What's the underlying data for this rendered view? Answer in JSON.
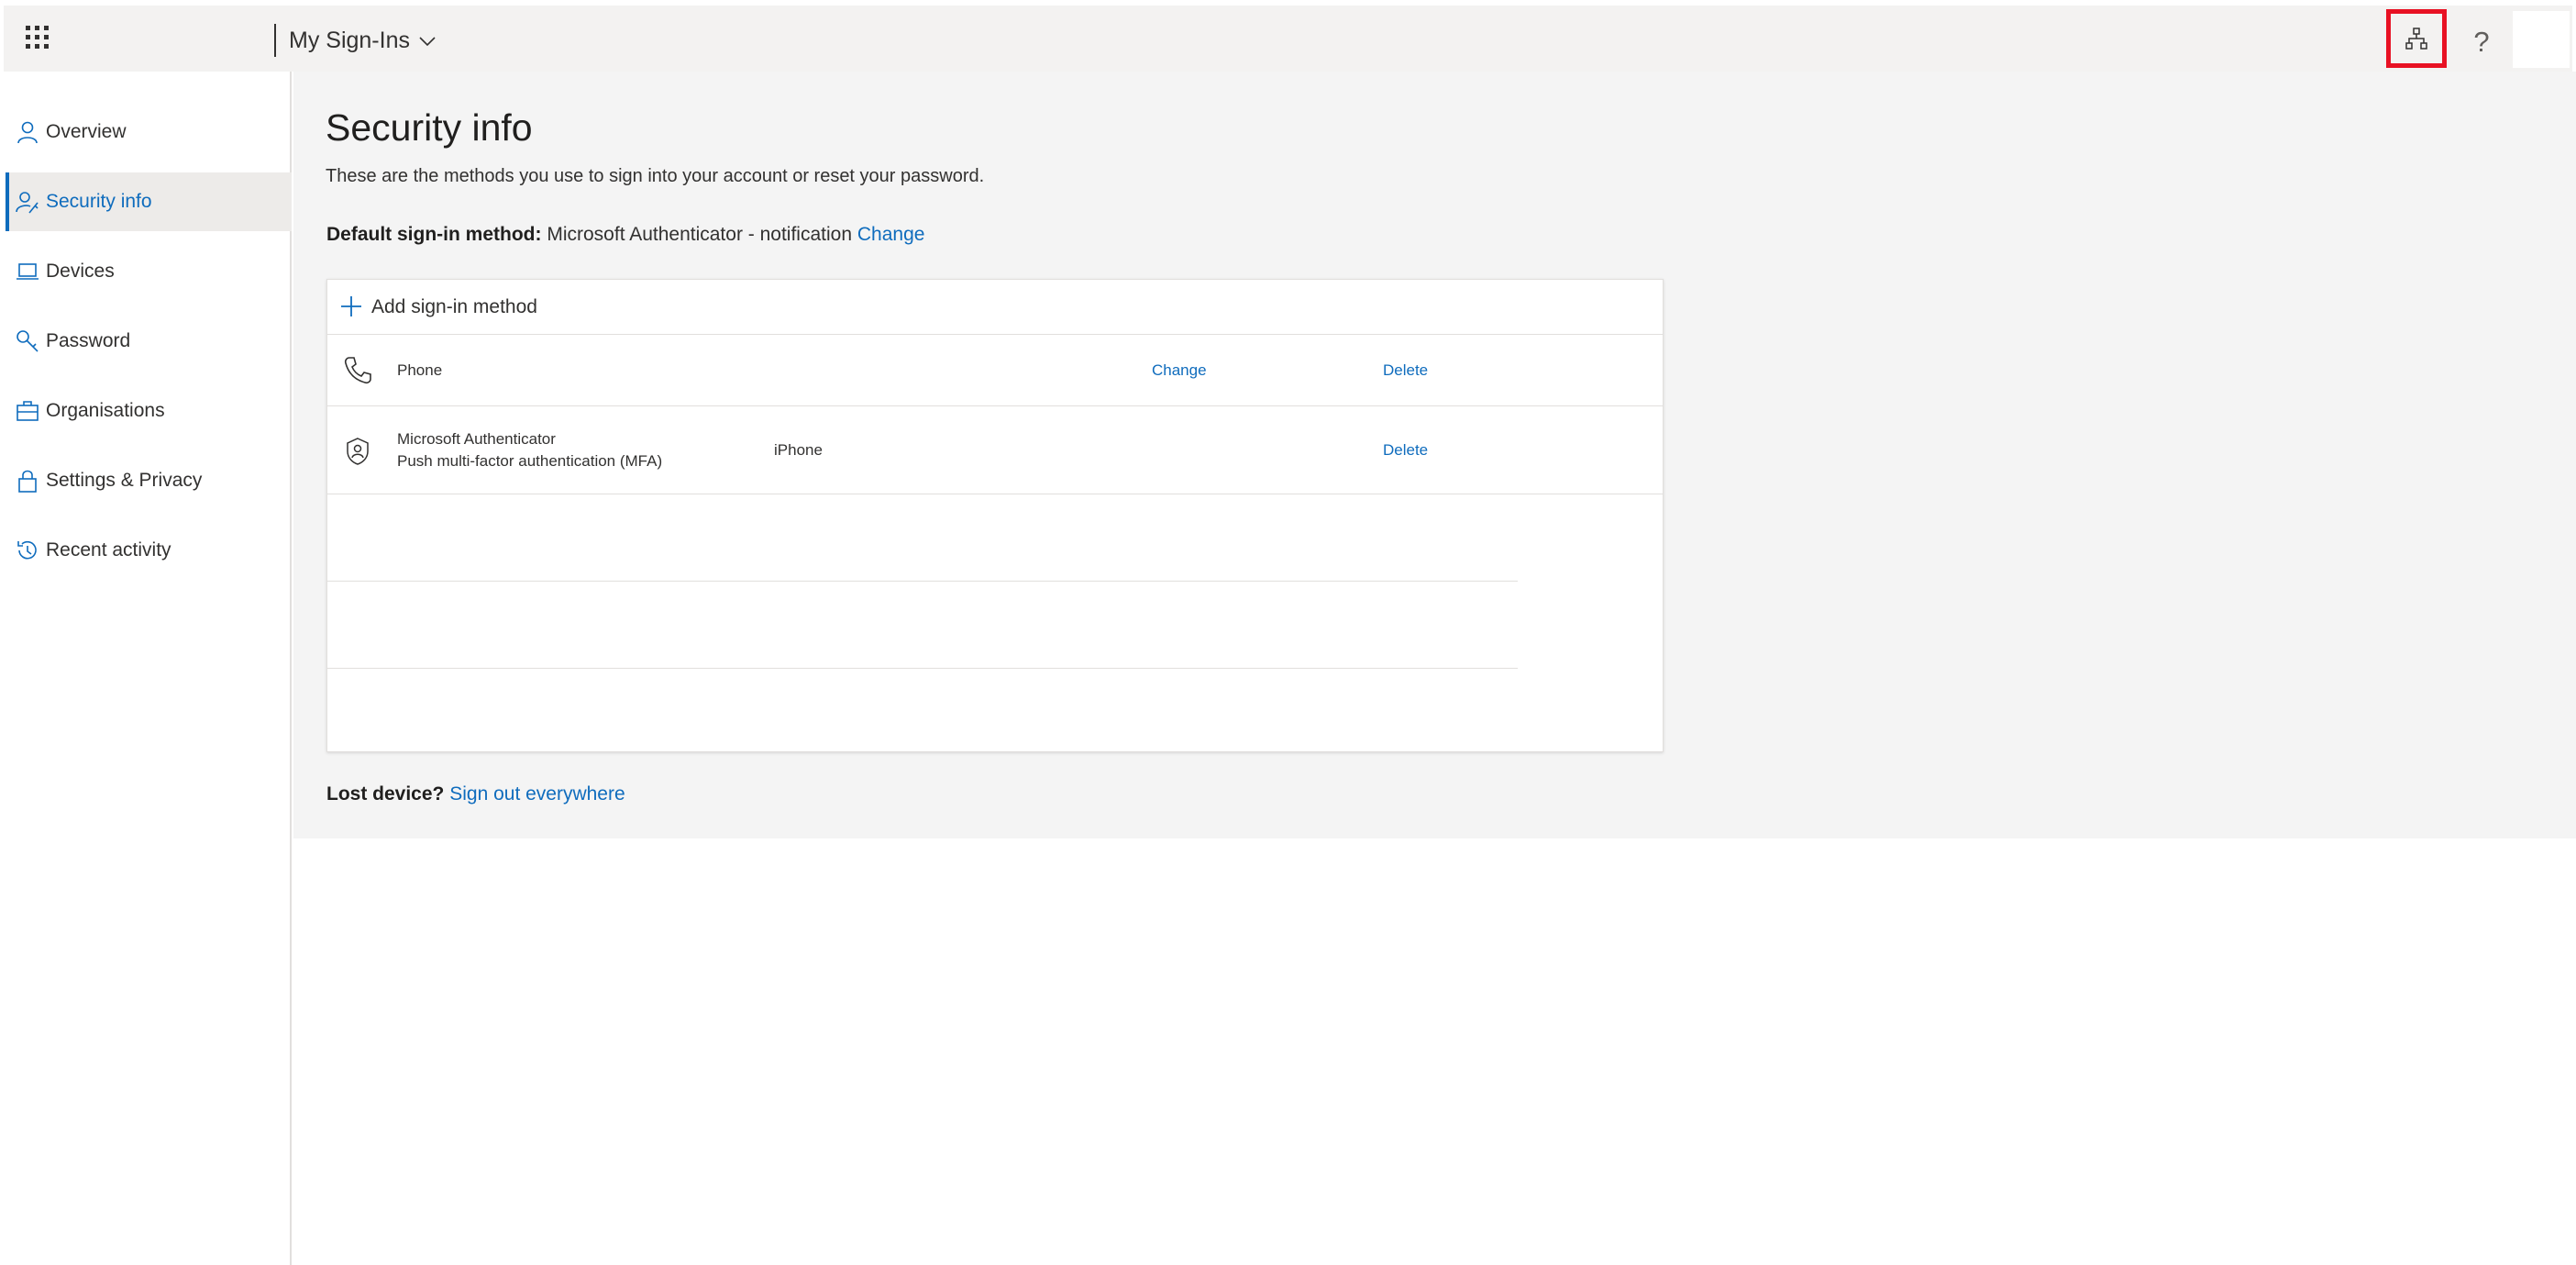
{
  "header": {
    "app_title": "My Sign-Ins",
    "waffle_icon": "app-launcher-icon",
    "org_icon": "organization-icon",
    "help_icon": "question-mark-icon",
    "help_glyph": "?"
  },
  "sidebar": {
    "items": [
      {
        "label": "Overview",
        "icon": "person-icon"
      },
      {
        "label": "Security info",
        "icon": "person-key-icon"
      },
      {
        "label": "Devices",
        "icon": "laptop-icon"
      },
      {
        "label": "Password",
        "icon": "key-icon"
      },
      {
        "label": "Organisations",
        "icon": "briefcase-icon"
      },
      {
        "label": "Settings & Privacy",
        "icon": "lock-icon"
      },
      {
        "label": "Recent activity",
        "icon": "history-icon"
      }
    ],
    "active": "Security info"
  },
  "main": {
    "title": "Security info",
    "description": "These are the methods you use to sign into your account or reset your password.",
    "default_method_label": "Default sign-in method:",
    "default_method_value": "Microsoft Authenticator - notification",
    "default_method_change": "Change",
    "add_method_label": "Add sign-in method",
    "methods": [
      {
        "name": "Phone",
        "subtitle": "",
        "detail": "",
        "change": "Change",
        "delete": "Delete",
        "icon": "phone-icon"
      },
      {
        "name": "Microsoft Authenticator",
        "subtitle": "Push multi-factor authentication (MFA)",
        "detail": "iPhone",
        "change": "",
        "delete": "Delete",
        "icon": "authenticator-icon"
      }
    ],
    "lost_device_label": "Lost device?",
    "sign_out_everywhere": "Sign out everywhere"
  },
  "colors": {
    "accent": "#0f6cbd",
    "highlight_border": "#e81123",
    "header_bg": "#f3f2f1",
    "content_bg": "#f4f4f4"
  }
}
